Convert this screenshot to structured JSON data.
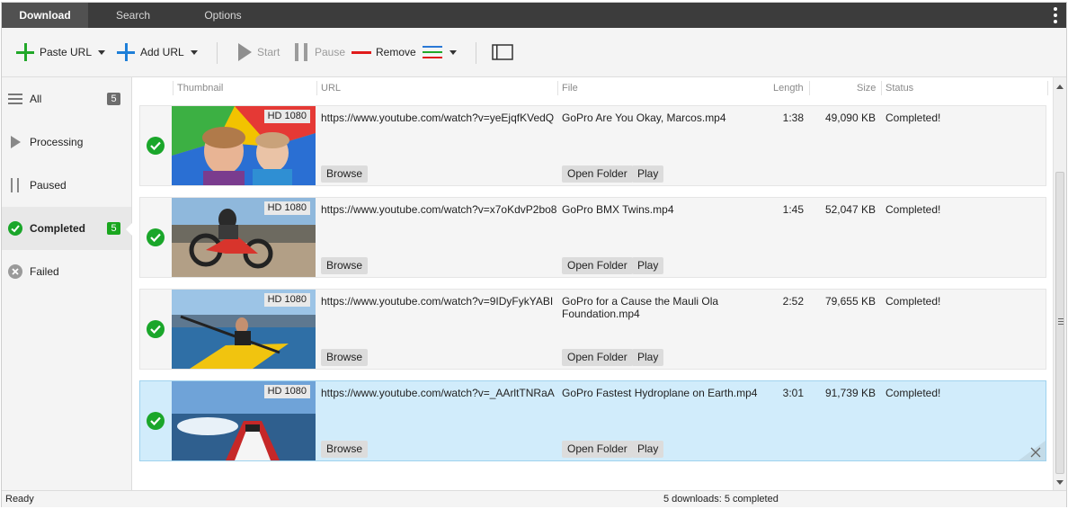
{
  "tabs": [
    {
      "label": "Download",
      "active": true
    },
    {
      "label": "Search",
      "active": false
    },
    {
      "label": "Options",
      "active": false
    }
  ],
  "toolbar": {
    "paste_url": "Paste URL",
    "add_url": "Add URL",
    "start": "Start",
    "pause": "Pause",
    "remove": "Remove"
  },
  "sidebar": {
    "items": [
      {
        "label": "All",
        "count": "5",
        "icon": "list-icon"
      },
      {
        "label": "Processing",
        "count": "",
        "icon": "play-icon"
      },
      {
        "label": "Paused",
        "count": "",
        "icon": "pause-icon"
      },
      {
        "label": "Completed",
        "count": "5",
        "icon": "check-circle-icon",
        "active": true
      },
      {
        "label": "Failed",
        "count": "",
        "icon": "x-circle-icon"
      }
    ]
  },
  "columns": {
    "thumbnail": "Thumbnail",
    "url": "URL",
    "file": "File",
    "length": "Length",
    "size": "Size",
    "status": "Status"
  },
  "buttons": {
    "browse": "Browse",
    "open_folder": "Open Folder",
    "play": "Play"
  },
  "rows": [
    {
      "quality": "HD 1080",
      "url": "https://www.youtube.com/watch?v=yeEjqfKVedQ",
      "file": "GoPro  Are You Okay, Marcos.mp4",
      "length": "1:38",
      "size": "49,090 KB",
      "status": "Completed!"
    },
    {
      "quality": "HD 1080",
      "url": "https://www.youtube.com/watch?v=x7oKdvP2bo8",
      "file": "GoPro  BMX Twins.mp4",
      "length": "1:45",
      "size": "52,047 KB",
      "status": "Completed!"
    },
    {
      "quality": "HD 1080",
      "url": "https://www.youtube.com/watch?v=9IDyFykYABI",
      "file": "GoPro for a Cause  the Mauli Ola Foundation.mp4",
      "length": "2:52",
      "size": "79,655 KB",
      "status": "Completed!"
    },
    {
      "quality": "HD 1080",
      "url": "https://www.youtube.com/watch?v=_AArltTNRaA",
      "file": "GoPro  Fastest Hydroplane on Earth.mp4",
      "length": "3:01",
      "size": "91,739 KB",
      "status": "Completed!",
      "selected": true
    }
  ],
  "status": {
    "left": "Ready",
    "center": "5 downloads: 5 completed"
  },
  "colors": {
    "accent_green": "#1aa62a",
    "selected_row": "#d1ecfb",
    "topbar": "#3c3c3c"
  }
}
